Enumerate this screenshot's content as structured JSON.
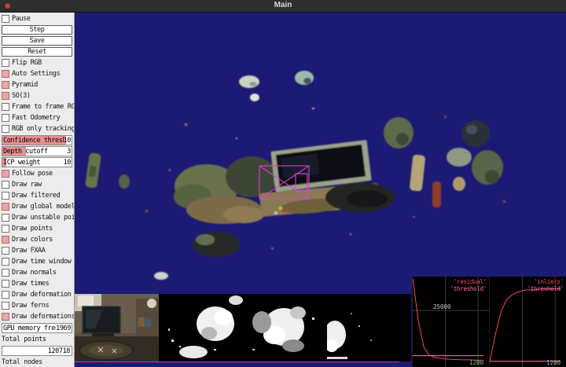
{
  "window": {
    "title": "Main"
  },
  "sidebar": {
    "items": [
      {
        "type": "checkbox",
        "label": "Pause",
        "checked": false
      },
      {
        "type": "button",
        "label": "Step"
      },
      {
        "type": "button",
        "label": "Save"
      },
      {
        "type": "button",
        "label": "Reset"
      },
      {
        "type": "checkbox",
        "label": "Flip RGB",
        "checked": false
      },
      {
        "type": "checkbox",
        "label": "Auto Settings",
        "checked": true
      },
      {
        "type": "checkbox",
        "label": "Pyramid",
        "checked": true
      },
      {
        "type": "checkbox",
        "label": "SO(3)",
        "checked": true
      },
      {
        "type": "checkbox",
        "label": "Frame to frame RGB",
        "checked": false
      },
      {
        "type": "checkbox",
        "label": "Fast Odometry",
        "checked": false
      },
      {
        "type": "checkbox",
        "label": "RGB only tracking",
        "checked": false
      },
      {
        "type": "slider",
        "label": "Confidence threshold",
        "value": "10",
        "fill": 0.92
      },
      {
        "type": "slider",
        "label": "Depth cutoff",
        "value": "3",
        "fill": 0.34
      },
      {
        "type": "slider",
        "label": "ICP weight",
        "value": "10",
        "fill": 0.06
      },
      {
        "type": "checkbox",
        "label": "Follow pose",
        "checked": true
      },
      {
        "type": "checkbox",
        "label": "Draw raw",
        "checked": false
      },
      {
        "type": "checkbox",
        "label": "Draw filtered",
        "checked": false
      },
      {
        "type": "checkbox",
        "label": "Draw global model",
        "checked": true
      },
      {
        "type": "checkbox",
        "label": "Draw unstable points",
        "checked": false
      },
      {
        "type": "checkbox",
        "label": "Draw points",
        "checked": false
      },
      {
        "type": "checkbox",
        "label": "Draw colors",
        "checked": true
      },
      {
        "type": "checkbox",
        "label": "Draw FXAA",
        "checked": false
      },
      {
        "type": "checkbox",
        "label": "Draw time window",
        "checked": false
      },
      {
        "type": "checkbox",
        "label": "Draw normals",
        "checked": false
      },
      {
        "type": "checkbox",
        "label": "Draw times",
        "checked": false
      },
      {
        "type": "checkbox",
        "label": "Draw deformation graph",
        "checked": false
      },
      {
        "type": "checkbox",
        "label": "Draw ferns",
        "checked": false
      },
      {
        "type": "checkbox",
        "label": "Draw deformations",
        "checked": true
      },
      {
        "type": "readout",
        "label": "GPU memory free",
        "value": "1969"
      },
      {
        "type": "plain",
        "label": "Total points"
      },
      {
        "type": "valuebox",
        "label": "Total points value",
        "value": "120718"
      },
      {
        "type": "plain",
        "label": "Total nodes"
      }
    ]
  },
  "colors": {
    "accent_checked": "#f0a2a2",
    "slider_fill": "#e88f8f",
    "viewport_bg": "#1b1b75",
    "frustum": "#e33fd4",
    "plot_bg": "#000000"
  },
  "chart_data": [
    {
      "type": "line",
      "title": "residual",
      "legend": [
        "'residual'",
        "'threshold'"
      ],
      "x": [
        0,
        100,
        200,
        300,
        400,
        500,
        600,
        700,
        800,
        900,
        1000,
        1100,
        1200,
        1300
      ],
      "series": [
        {
          "name": "residual",
          "color": "#ff4558",
          "values": [
            39500,
            21000,
            9000,
            5200,
            4300,
            3900,
            3600,
            3400,
            3300,
            3200,
            3150,
            3100,
            3050,
            3000
          ]
        },
        {
          "name": "threshold",
          "color": "#ff6fbe",
          "values": [
            5000,
            5000,
            5000,
            5000,
            5000,
            5000,
            5000,
            5000,
            5000,
            5000,
            5000,
            5000,
            5000,
            5000
          ]
        }
      ],
      "xlim": [
        0,
        1400
      ],
      "ylim": [
        0,
        40000
      ],
      "yticks": [
        {
          "label": "25000",
          "value": 25000
        }
      ],
      "xticks": [
        {
          "label": "1200",
          "value": 1200
        }
      ],
      "extra_vgrid": [
        600
      ],
      "grid": true,
      "legend_position": "top-right"
    },
    {
      "type": "line",
      "title": "inliers",
      "legend": [
        "'inliers'",
        "'threshold'"
      ],
      "x": [
        0,
        100,
        200,
        300,
        400,
        500,
        600,
        700,
        800,
        900,
        1000,
        1100,
        1200,
        1300
      ],
      "series": [
        {
          "name": "inliers",
          "color": "#ff4558",
          "values": [
            2500,
            14000,
            24000,
            29500,
            31800,
            33000,
            33800,
            34200,
            34000,
            34400,
            34600,
            34500,
            34600,
            34650
          ]
        },
        {
          "name": "threshold",
          "color": "#ff6fbe",
          "values": [
            2500,
            2500,
            2500,
            2500,
            2500,
            2500,
            2500,
            2500,
            2500,
            2500,
            2500,
            2500,
            2500,
            2500
          ]
        }
      ],
      "xlim": [
        0,
        1400
      ],
      "ylim": [
        0,
        40000
      ],
      "yticks": [],
      "xticks": [
        {
          "label": "1200",
          "value": 1200
        }
      ],
      "extra_vgrid": [
        600
      ],
      "grid": true,
      "legend_position": "top-right"
    }
  ]
}
